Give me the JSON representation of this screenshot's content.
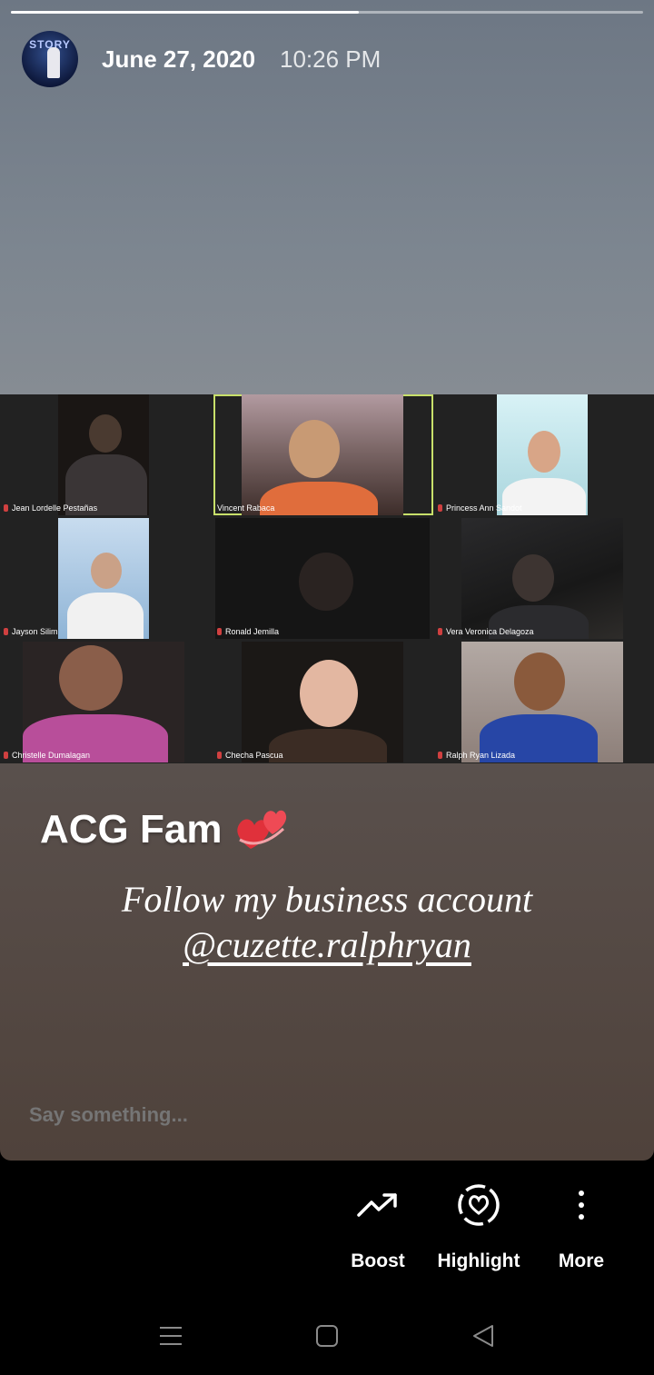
{
  "story": {
    "date": "June 27, 2020",
    "time": "10:26 PM",
    "progress": 0.55,
    "avatar_icon": "profile-avatar-icon"
  },
  "grid": {
    "participants": [
      {
        "name": "Jean Lordelle Pestañas"
      },
      {
        "name": "Vincent Rabaca",
        "active": true
      },
      {
        "name": "Princess Ann Sandot"
      },
      {
        "name": "Jayson Silim"
      },
      {
        "name": "Ronald Jemilla"
      },
      {
        "name": "Vera Veronica Delagoza"
      },
      {
        "name": "Christelle Dumalagan"
      },
      {
        "name": "Checha Pascua"
      },
      {
        "name": "Ralph Ryan Lizada"
      }
    ],
    "active_border_color": "#c8e06a"
  },
  "caption": {
    "title": "ACG Fam",
    "line1": "Follow my business account",
    "handle": "@cuzette.ralphryan"
  },
  "reply": {
    "placeholder": "Say something..."
  },
  "actions": {
    "boost": "Boost",
    "highlight": "Highlight",
    "more": "More"
  },
  "nav": {
    "recents_icon": "recents-icon",
    "home_icon": "home-icon",
    "back_icon": "back-icon"
  }
}
